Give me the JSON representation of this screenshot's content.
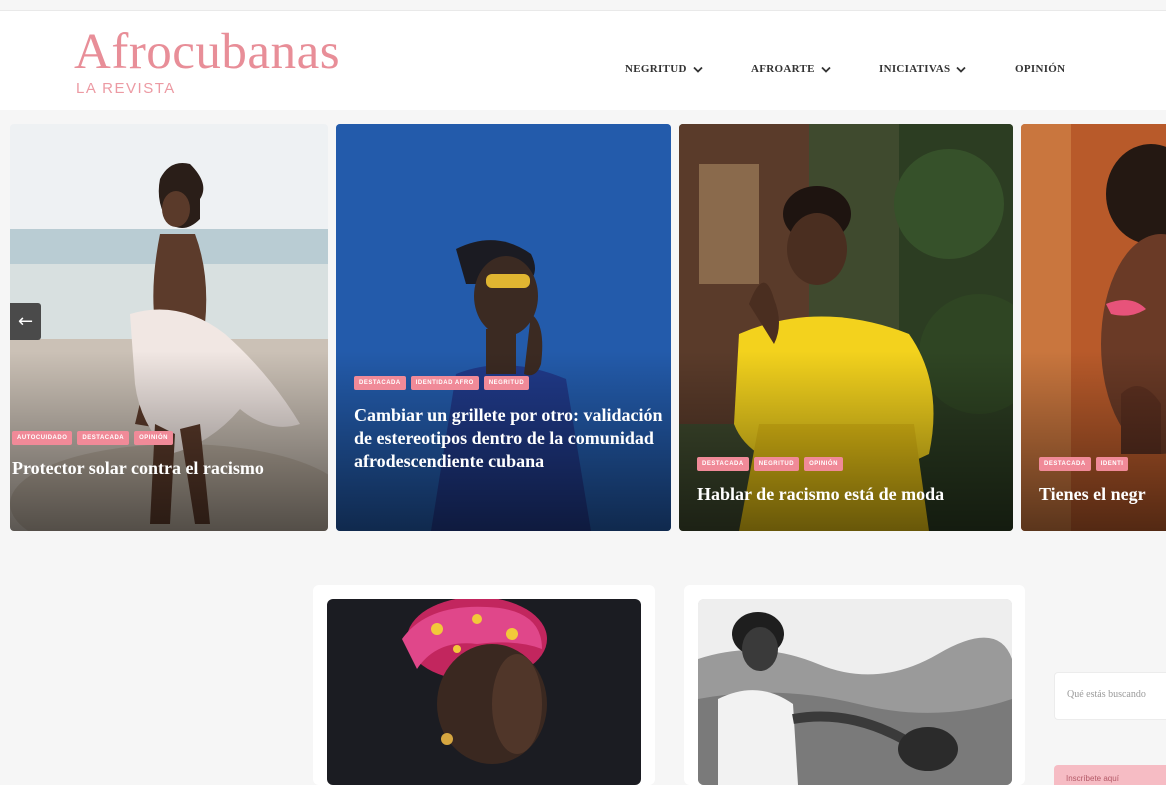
{
  "header": {
    "logo_title": "Afrocubanas",
    "logo_subtitle": "LA REVISTA",
    "brand_color": "#e88e98",
    "nav": [
      {
        "label": "NEGRITUD",
        "has_dropdown": true
      },
      {
        "label": "AFROARTE",
        "has_dropdown": true
      },
      {
        "label": "INICIATIVAS",
        "has_dropdown": true
      },
      {
        "label": "OPINIÓN",
        "has_dropdown": false
      }
    ]
  },
  "slider": {
    "prev_arrow": "←",
    "cards": [
      {
        "tags": [
          "AUTOCUIDADO",
          "DESTACADA",
          "OPINIÓN"
        ],
        "title": "Protector solar contra el racismo"
      },
      {
        "tags": [
          "DESTACADA",
          "IDENTIDAD AFRO",
          "NEGRITUD"
        ],
        "title": "Cambiar un grillete por otro: validación de estereotipos dentro de la comunidad afrodescendiente cubana"
      },
      {
        "tags": [
          "DESTACADA",
          "NEGRITUD",
          "OPINIÓN"
        ],
        "title": "Hablar de racismo está de moda"
      },
      {
        "tags": [
          "DESTACADA",
          "IDENTI"
        ],
        "title": "Tienes el negr"
      }
    ],
    "tag_color": "#f08a98"
  },
  "sidebar": {
    "search_placeholder": "Qué estás buscando",
    "button_label": "Inscríbete aquí"
  }
}
